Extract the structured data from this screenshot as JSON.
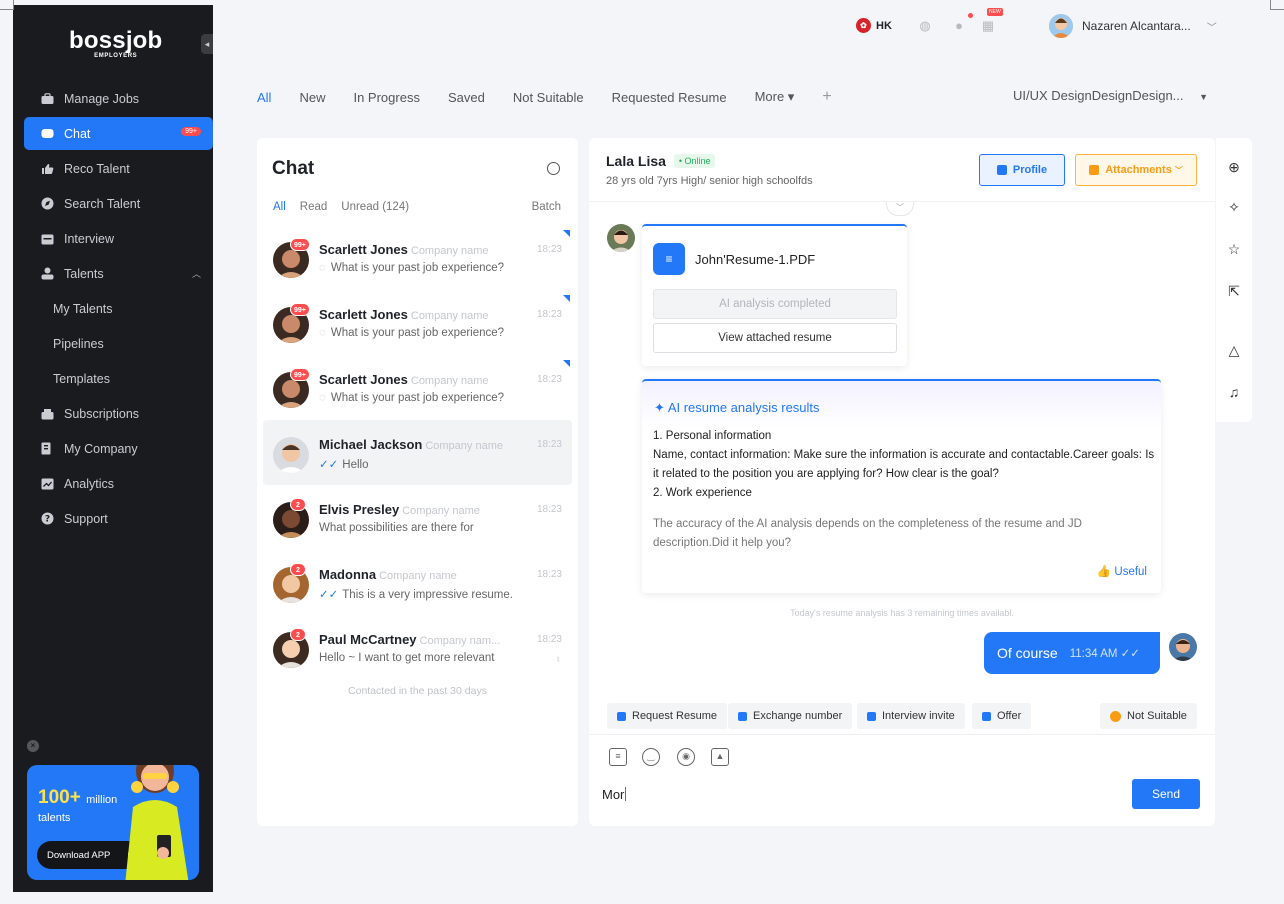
{
  "brand": {
    "name": "bossjob",
    "sub": "EMPLOYERS"
  },
  "sidebar": {
    "items": [
      {
        "label": "Manage Jobs",
        "icon": "briefcase-icon"
      },
      {
        "label": "Chat",
        "icon": "chat-icon",
        "badge": "99+"
      },
      {
        "label": "Reco Talent",
        "icon": "thumbs-up-icon"
      },
      {
        "label": "Search Talent",
        "icon": "compass-icon"
      },
      {
        "label": "Interview",
        "icon": "calendar-icon"
      },
      {
        "label": "Talents",
        "icon": "people-icon"
      },
      {
        "label": "My Talents"
      },
      {
        "label": "Pipelines"
      },
      {
        "label": "Templates"
      },
      {
        "label": "Subscriptions",
        "icon": "crown-icon"
      },
      {
        "label": "My Company",
        "icon": "building-icon"
      },
      {
        "label": "Analytics",
        "icon": "chart-icon"
      },
      {
        "label": "Support",
        "icon": "help-icon"
      }
    ],
    "promo": {
      "big": "100+",
      "unit": "million",
      "sub": "talents",
      "button": "Download APP"
    }
  },
  "topbar": {
    "region": "HK",
    "new_badge": "NEW",
    "user_name": "Nazaren Alcantara..."
  },
  "tabs": [
    "All",
    "New",
    "In Progress",
    "Saved",
    "Not Suitable",
    "Requested Resume",
    "More ▾"
  ],
  "job_select": "UI/UX DesignDesignDesign...",
  "chat_list": {
    "title": "Chat",
    "filters": [
      "All",
      "Read",
      "Unread (124)"
    ],
    "batch": "Batch",
    "items": [
      {
        "name": "Scarlett Jones",
        "company": "Company name",
        "time": "18:23",
        "message": "What is your past job experience?",
        "badge": "99+"
      },
      {
        "name": "Scarlett Jones",
        "company": "Company name",
        "time": "18:23",
        "message": "What is your past job experience?",
        "badge": "99+"
      },
      {
        "name": "Scarlett Jones",
        "company": "Company name",
        "time": "18:23",
        "message": "What is your past job experience?",
        "badge": "99+"
      },
      {
        "name": "Michael Jackson",
        "company": "Company name",
        "time": "18:23",
        "message": "Hello",
        "badge": ""
      },
      {
        "name": "Elvis Presley",
        "company": "Company name",
        "time": "18:23",
        "message": "What possibilities are there for",
        "badge": "2"
      },
      {
        "name": "Madonna",
        "company": "Company name",
        "time": "18:23",
        "message": "This is a very impressive resume.",
        "badge": "2"
      },
      {
        "name": "Paul McCartney",
        "company": "Company nam...",
        "time": "18:23",
        "message": "Hello ~ I want to get more relevant",
        "badge": "2"
      }
    ],
    "footer": "Contacted in the past 30 days"
  },
  "conversation": {
    "name": "Lala Lisa",
    "status": "Online",
    "meta": "28 yrs old  7yrs  High/ senior high schoolfds",
    "profile_btn": "Profile",
    "attach_btn": "Attachments",
    "file_name": "John'Resume-1.PDF",
    "file_status": "AI analysis completed",
    "file_view": "View attached resume",
    "ai_title": "AI resume analysis results",
    "ai_lines": [
      "1. Personal information",
      "Name, contact information: Make sure the information is accurate and contactable.Career goals: Is it related to the position you are applying for? How clear is the goal?",
      "2. Work experience"
    ],
    "ai_note": "The accuracy of the AI analysis depends on the completeness of the resume and JD description.Did it help you?",
    "ai_useful": "Useful",
    "remaining": "Today's resume analysis has 3 remaining times availabl.",
    "my_message": "Of course",
    "my_time": "11:34 AM",
    "actions": [
      "Request Resume",
      "Exchange number",
      "Interview invite",
      "Offer",
      "Not Suitable"
    ],
    "input_value": "Mor",
    "send": "Send"
  },
  "colors": {
    "accent": "#2378f7",
    "sidebar_bg": "#1a1b1f",
    "badge": "#ff4d4f",
    "warning": "#fa9b14",
    "online": "#20b05a"
  }
}
